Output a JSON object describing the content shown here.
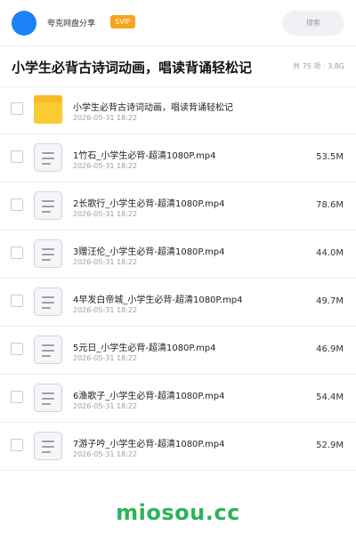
{
  "header": {
    "uploader_name": "夸克网盘分享",
    "badge": "SVIP",
    "search_placeholder": "搜索"
  },
  "share": {
    "title": "小学生必背古诗词动画，唱读背诵轻松记",
    "summary": "共 75 项 · 3.8G"
  },
  "items": [
    {
      "type": "folder",
      "name": "小学生必背古诗词动画，唱读背诵轻松记",
      "date": "2026-05-31 18:22",
      "size": ""
    },
    {
      "type": "file",
      "name": "1竹石_小学生必背-超清1080P.mp4",
      "date": "2026-05-31 18:22",
      "size": "53.5M"
    },
    {
      "type": "file",
      "name": "2长歌行_小学生必背-超清1080P.mp4",
      "date": "2026-05-31 18:22",
      "size": "78.6M"
    },
    {
      "type": "file",
      "name": "3赠汪伦_小学生必背-超清1080P.mp4",
      "date": "2026-05-31 18:22",
      "size": "44.0M"
    },
    {
      "type": "file",
      "name": "4早发白帝城_小学生必背-超清1080P.mp4",
      "date": "2026-05-31 18:22",
      "size": "49.7M"
    },
    {
      "type": "file",
      "name": "5元日_小学生必背-超清1080P.mp4",
      "date": "2026-05-31 18:22",
      "size": "46.9M"
    },
    {
      "type": "file",
      "name": "6渔歌子_小学生必背-超清1080P.mp4",
      "date": "2026-05-31 18:22",
      "size": "54.4M"
    },
    {
      "type": "file",
      "name": "7游子吟_小学生必背-超清1080P.mp4",
      "date": "2026-05-31 18:22",
      "size": "52.9M"
    }
  ],
  "watermark": "miosou.cc",
  "colors": {
    "avatar": "#1d82f5",
    "badge": "#f8a31c",
    "folder": "#fccb32",
    "watermark": "#2db35a"
  }
}
